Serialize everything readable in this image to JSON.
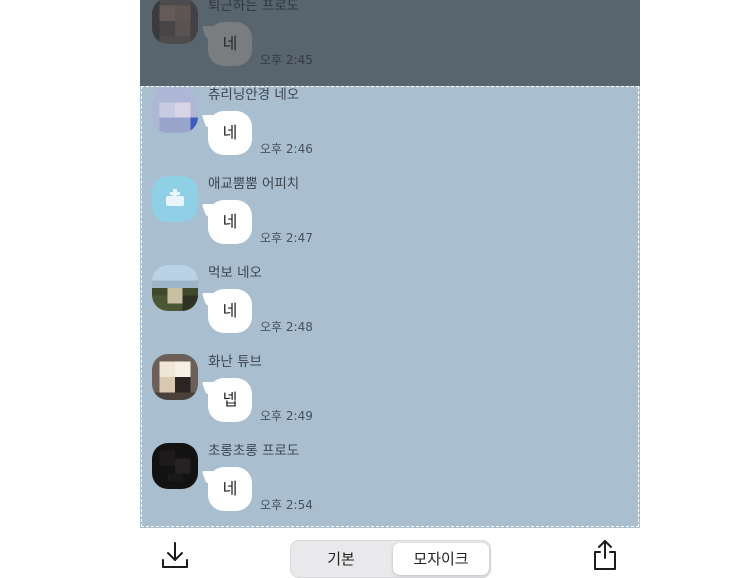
{
  "messages": [
    {
      "sender": "퇴근하는 프로도",
      "text": "네",
      "time": "오후 2:45"
    },
    {
      "sender": "츄리닝안경 네오",
      "text": "네",
      "time": "오후 2:46"
    },
    {
      "sender": "애교뿜뿜 어피치",
      "text": "네",
      "time": "오후 2:47"
    },
    {
      "sender": "먹보 네오",
      "text": "네",
      "time": "오후 2:48"
    },
    {
      "sender": "화난 튜브",
      "text": "넵",
      "time": "오후 2:49"
    },
    {
      "sender": "초롱초롱 프로도",
      "text": "네",
      "time": "오후 2:54"
    }
  ],
  "toolbar": {
    "download_icon": "download-icon",
    "share_icon": "share-icon",
    "segment": {
      "basic_label": "기본",
      "mosaic_label": "모자이크",
      "selected": "모자이크"
    }
  },
  "colors": {
    "chat_background": "#a9bfcf",
    "bubble": "#ffffff",
    "dim_overlay": "#4f5860",
    "selection_border": "#ffffff"
  }
}
